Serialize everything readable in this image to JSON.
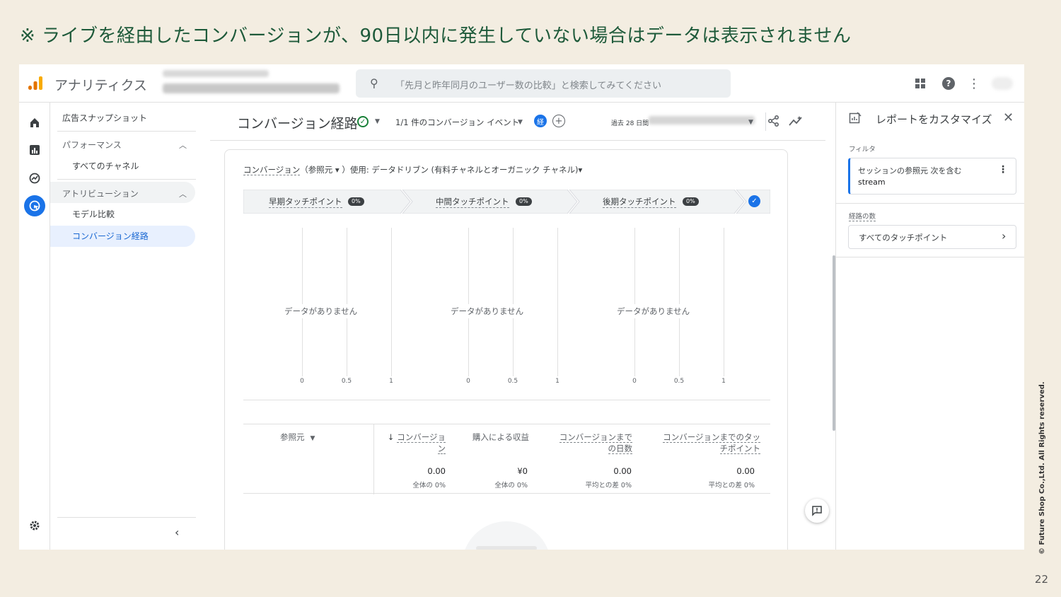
{
  "slide": {
    "title": "※ ライブを経由したコンバージョンが、90日以内に発生していない場合はデータは表示されません",
    "copyright": "© Future Shop Co.,Ltd. All Rights reserved.",
    "page_number": "22"
  },
  "topbar": {
    "app_name": "アナリティクス",
    "search_placeholder": "「先月と昨年同月のユーザー数の比較」と検索してみてください",
    "icons": [
      "apps-icon",
      "help-icon",
      "more-vert-icon"
    ],
    "help_glyph": "?"
  },
  "nav": {
    "title": "広告スナップショット",
    "groups": [
      {
        "label": "パフォーマンス",
        "items": [
          "すべてのチャネル"
        ]
      },
      {
        "label": "アトリビューション",
        "items": [
          "モデル比較",
          "コンバージョン経路"
        ]
      }
    ],
    "selected_item": "コンバージョン経路"
  },
  "header": {
    "page_title": "コンバージョン経路",
    "event_selector": "1/1 件のコンバージョン イベント",
    "chip_label": "経",
    "date_range_label": "過去 28 日間"
  },
  "card": {
    "subtitle_dimension": "コンバージョン",
    "subtitle_rest": "（参照元 ▾ ）使用: データドリブン (有料チャネルとオーガニック チャネル)▾",
    "stages": [
      {
        "label": "早期タッチポイント",
        "pct": "0%"
      },
      {
        "label": "中間タッチポイント",
        "pct": "0%"
      },
      {
        "label": "後期タッチポイント",
        "pct": "0%"
      }
    ],
    "no_data": "データがありません",
    "axis_ticks": [
      "0",
      "0.5",
      "1"
    ],
    "table": {
      "dimension_header": "参照元",
      "columns": [
        {
          "header": "コンバージョン",
          "value": "0.00",
          "sub": "全体の 0%"
        },
        {
          "header": "購入による収益",
          "value": "¥0",
          "sub": "全体の 0%"
        },
        {
          "header": "コンバージョンまでの日数",
          "value": "0.00",
          "sub": "平均との差 0%"
        },
        {
          "header": "コンバージョンまでのタッチポイント",
          "value": "0.00",
          "sub": "平均との差 0%"
        }
      ]
    }
  },
  "panel": {
    "title": "レポートをカスタマイズ",
    "filter_label": "フィルタ",
    "filter_line1": "セッションの参照元 次を含む",
    "filter_line2": "stream",
    "paths_label": "経路の数",
    "paths_value": "すべてのタッチポイント"
  },
  "colors": {
    "accent": "#1a73e8",
    "slide_title": "#1e5a3a",
    "background": "#f3ede1"
  }
}
